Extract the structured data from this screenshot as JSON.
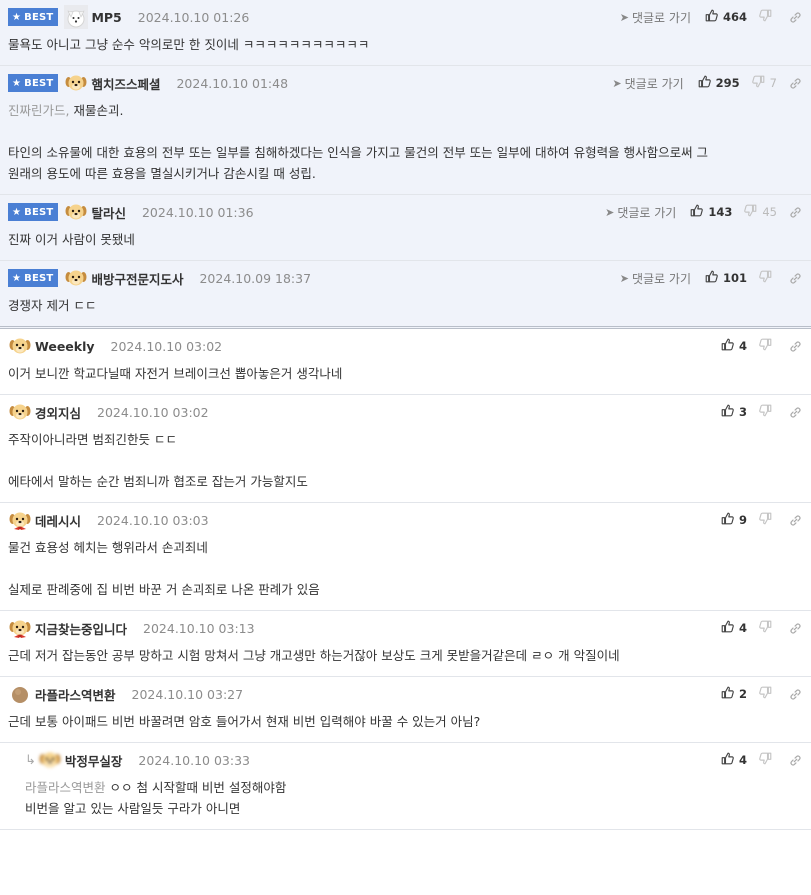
{
  "labels": {
    "best": "BEST",
    "reply_link": "댓글로 가기"
  },
  "colors": {
    "best_badge": "#4a7fd4",
    "best_row_bg": "#f0f3fa",
    "meta_gray": "#8c8c8c"
  },
  "best_comments": [
    {
      "nick": "MP5",
      "date": "2024.10.10 01:26",
      "likes": "464",
      "dislikes": "",
      "avatar": "white-dog-icon",
      "lines": [
        "물욕도 아니고 그냥 순수 악의로만 한 짓이네 ㅋㅋㅋㅋㅋㅋㅋㅋㅋㅋㅋ"
      ]
    },
    {
      "nick": "햄치즈스페셜",
      "date": "2024.10.10 01:48",
      "likes": "295",
      "dislikes": "7",
      "avatar": "puppy-icon",
      "mention": "진짜린가드,",
      "lines": [
        "재물손괴.",
        "",
        "타인의 소유물에 대한 효용의 전부 또는 일부를 침해하겠다는 인식을 가지고 물건의 전부 또는 일부에 대하여 유형력을 행사함으로써 그",
        "원래의 용도에 따른 효용을 멸실시키거나 감손시킬 때 성립."
      ]
    },
    {
      "nick": "탈라신",
      "date": "2024.10.10 01:36",
      "likes": "143",
      "dislikes": "45",
      "avatar": "puppy-icon",
      "lines": [
        "진짜 이거 사람이 못됐네"
      ]
    },
    {
      "nick": "배방구전문지도사",
      "date": "2024.10.09 18:37",
      "likes": "101",
      "dislikes": "",
      "avatar": "puppy-icon",
      "lines": [
        "경쟁자 제거 ㄷㄷ"
      ]
    }
  ],
  "comments": [
    {
      "nick": "Weeekly",
      "date": "2024.10.10 03:02",
      "likes": "4",
      "avatar": "puppy-icon",
      "lines": [
        "이거 보니깐 학교다닐때 자전거 브레이크선 뽑아놓은거 생각나네"
      ]
    },
    {
      "nick": "경외지심",
      "date": "2024.10.10 03:02",
      "likes": "3",
      "avatar": "puppy-icon",
      "lines": [
        "주작이아니라면 범죄긴한듯 ㄷㄷ",
        "",
        "에타에서 말하는 순간 범죄니까 협조로 잡는거 가능할지도"
      ]
    },
    {
      "nick": "데레시시",
      "date": "2024.10.10 03:03",
      "likes": "9",
      "avatar": "puppy-bow-icon",
      "lines": [
        "물건 효용성 헤치는 행위라서 손괴죄네",
        "",
        "실제로 판례중에 집 비번 바꾼 거 손괴죄로 나온 판례가 있음"
      ]
    },
    {
      "nick": "지금찾는중입니다",
      "date": "2024.10.10 03:13",
      "likes": "4",
      "avatar": "puppy-bow-icon",
      "lines": [
        "근데 저거 잡는동안 공부 망하고 시험 망쳐서 그냥 개고생만 하는거잖아 보상도 크게 못받을거같은데 ㄹㅇ 개 악질이네"
      ]
    },
    {
      "nick": "라플라스역변환",
      "date": "2024.10.10 03:27",
      "likes": "2",
      "avatar": "round-avatar-icon",
      "lines": [
        "근데 보통 아이패드 비번 바꿀려면 암호 들어가서 현재 비번 입력해야 바꿀 수 있는거 아님?"
      ]
    }
  ],
  "reply": {
    "nick": "박정무실장",
    "date": "2024.10.10 03:33",
    "likes": "4",
    "avatar": "puppy-icon",
    "mention": "라플라스역변환",
    "lines": [
      "ㅇㅇ 첨 시작할때 비번 설정해야함",
      "비번을 알고 있는 사람일듯 구라가 아니면"
    ]
  }
}
